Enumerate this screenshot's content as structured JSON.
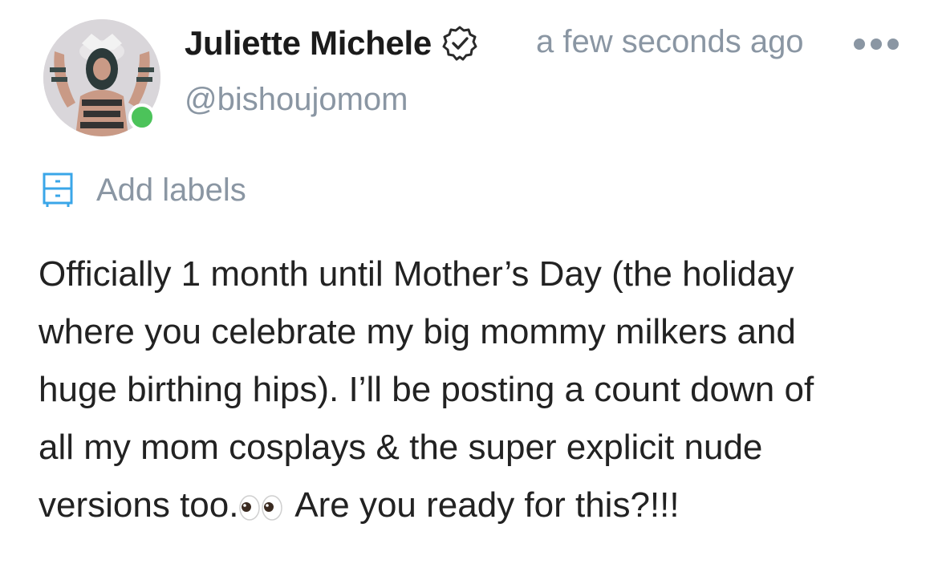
{
  "author": {
    "display_name": "Juliette Michele",
    "handle": "@bishoujomom",
    "verified_icon": "verified-badge-icon",
    "online": true
  },
  "post": {
    "timestamp": "a few seconds ago",
    "more_icon": "ellipsis-icon",
    "text_before_emoji": "Officially 1 month until Mother’s Day (the holiday\nwhere you celebrate my big mommy milkers and\nhuge birthing hips). I’ll be posting a count down of\nall my mom cosplays & the super explicit nude\nversions too.",
    "emoji": "👀",
    "text_after_emoji": " Are you ready for this?!!!"
  },
  "labels": {
    "icon": "labels-drawer-icon",
    "text": "Add labels"
  },
  "colors": {
    "muted_text": "#8a96a3",
    "accent_blue": "#3aa6e8",
    "online_green": "#4cc35a",
    "body_text": "#222222"
  }
}
